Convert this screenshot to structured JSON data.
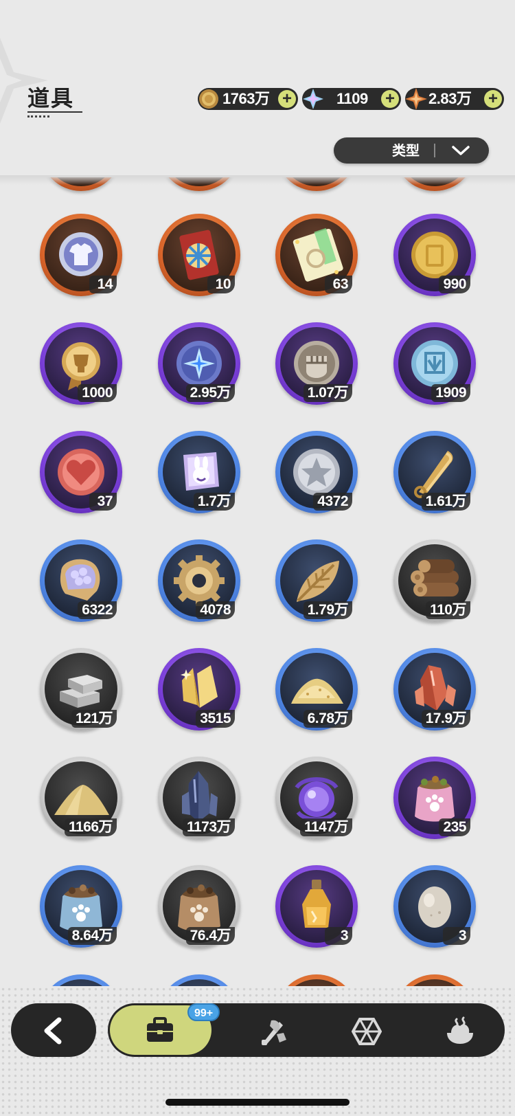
{
  "header": {
    "title": "道具",
    "currencies": [
      {
        "name": "gold-coin",
        "value": "1763万"
      },
      {
        "name": "crystal",
        "value": "1109"
      },
      {
        "name": "star-shard",
        "value": "2.83万"
      }
    ],
    "filter": {
      "label": "类型"
    }
  },
  "items": [
    {
      "icon": "shirt-medal",
      "rarity": "orange",
      "count": "14"
    },
    {
      "icon": "wheel-ticket",
      "rarity": "orange",
      "count": "10"
    },
    {
      "icon": "rainbow-ticket",
      "rarity": "orange",
      "count": "63"
    },
    {
      "icon": "gold-coin-token",
      "rarity": "purple",
      "count": "990"
    },
    {
      "icon": "trophy-medal",
      "rarity": "purple",
      "count": "1000"
    },
    {
      "icon": "star-orb",
      "rarity": "purple",
      "count": "2.95万"
    },
    {
      "icon": "fist-coin",
      "rarity": "purple",
      "count": "1.07万"
    },
    {
      "icon": "blue-coin",
      "rarity": "purple",
      "count": "1909"
    },
    {
      "icon": "heart-coin",
      "rarity": "purple",
      "count": "37"
    },
    {
      "icon": "bunny-badge",
      "rarity": "blue",
      "count": "1.7万"
    },
    {
      "icon": "silver-star-coin",
      "rarity": "blue",
      "count": "4372"
    },
    {
      "icon": "golden-blade",
      "rarity": "blue",
      "count": "1.61万"
    },
    {
      "icon": "scale-pouch",
      "rarity": "blue",
      "count": "6322"
    },
    {
      "icon": "gear",
      "rarity": "blue",
      "count": "4078"
    },
    {
      "icon": "golden-leaf",
      "rarity": "blue",
      "count": "1.79万"
    },
    {
      "icon": "wood-logs",
      "rarity": "gray",
      "count": "110万"
    },
    {
      "icon": "stone-bricks",
      "rarity": "gray",
      "count": "121万"
    },
    {
      "icon": "gold-crystal",
      "rarity": "purple",
      "count": "3515"
    },
    {
      "icon": "gold-dust",
      "rarity": "blue",
      "count": "6.78万"
    },
    {
      "icon": "red-crystal",
      "rarity": "blue",
      "count": "17.9万"
    },
    {
      "icon": "sand-pile",
      "rarity": "gray",
      "count": "1166万"
    },
    {
      "icon": "dark-crystal",
      "rarity": "gray",
      "count": "1173万"
    },
    {
      "icon": "purple-orb",
      "rarity": "gray",
      "count": "1147万"
    },
    {
      "icon": "pink-food-sack",
      "rarity": "purple",
      "count": "235"
    },
    {
      "icon": "blue-food-sack",
      "rarity": "blue",
      "count": "8.64万"
    },
    {
      "icon": "brown-food-sack",
      "rarity": "gray",
      "count": "76.4万"
    },
    {
      "icon": "potion-bottle",
      "rarity": "purple",
      "count": "3"
    },
    {
      "icon": "egg",
      "rarity": "blue",
      "count": "3"
    }
  ],
  "bottom_nav": {
    "badge": "99+",
    "tabs": [
      {
        "icon": "bag-icon",
        "active": true
      },
      {
        "icon": "equipment-icon",
        "active": false
      },
      {
        "icon": "gem-icon",
        "active": false
      },
      {
        "icon": "food-icon",
        "active": false
      }
    ]
  },
  "colors": {
    "accent": "#cfd67d",
    "bar": "#262626",
    "badge": "#4aa3e6"
  }
}
